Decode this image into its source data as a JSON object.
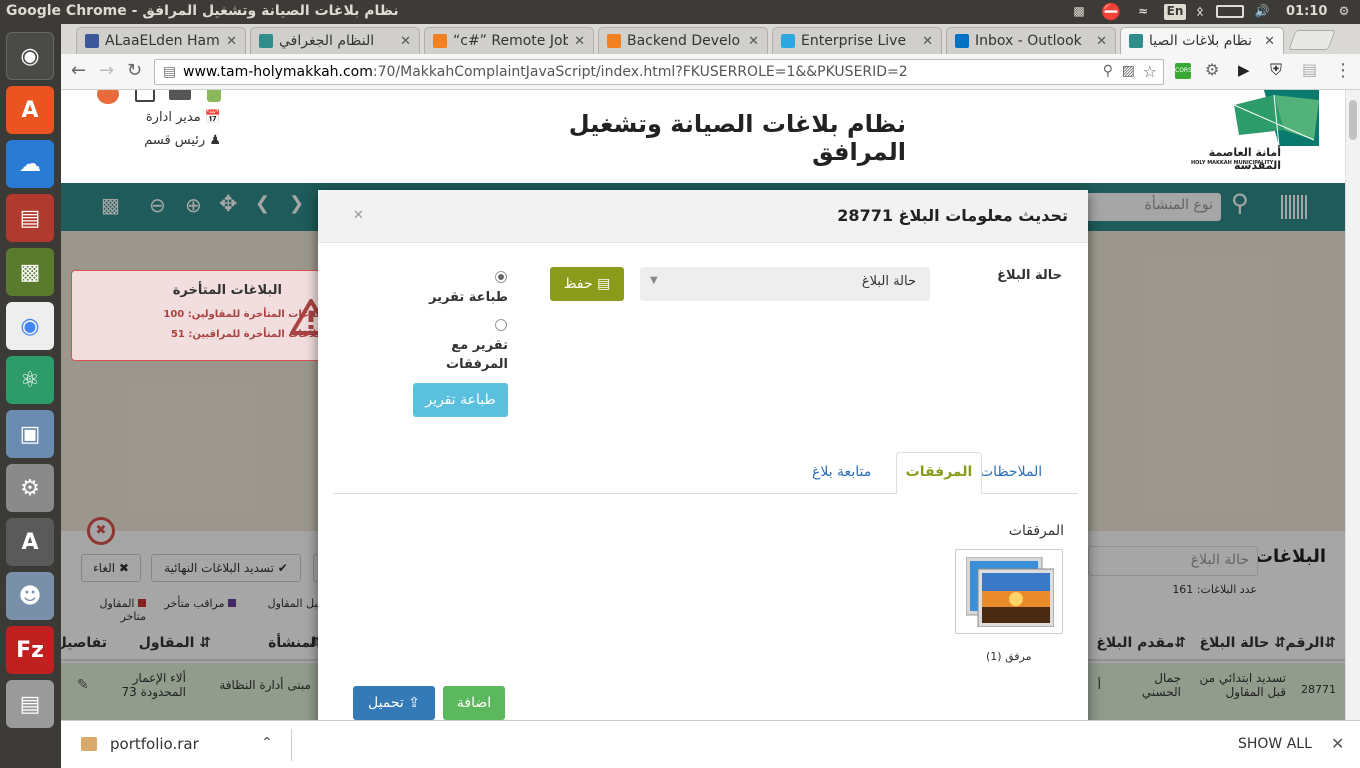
{
  "system": {
    "window_title": "Google Chrome - نظام بلاغات الصيانة وتشغيل المرافق",
    "lang": "En",
    "clock": "01:10"
  },
  "tabs": [
    {
      "label": "ALaaELden Ham",
      "color": "#3b5998"
    },
    {
      "label": "النظام الجغرافي",
      "color": "#2f8d8a"
    },
    {
      "label": "“c#” Remote Job",
      "color": "#f48024"
    },
    {
      "label": "Backend Develo",
      "color": "#f48024"
    },
    {
      "label": "Enterprise Live",
      "color": "#2ea7e0"
    },
    {
      "label": "Inbox - Outlook",
      "color": "#0072c6"
    },
    {
      "label": "نظام بلاغات الصيا",
      "color": "#2f8d8a"
    }
  ],
  "address": {
    "host": "www.tam-holymakkah.com",
    "path": ":70/MakkahComplaintJavaScript/index.html?FKUSERROLE=1&&PKUSERID=2"
  },
  "header": {
    "title": "نظام بلاغات الصيانة وتشغيل المرافق",
    "logo_ar": "أمانة العاصمة المقدسة",
    "logo_en": "HOLY MAKKAH MUNICIPALITY",
    "role1": "مدير ادارة",
    "role2": "رئيس قسم"
  },
  "mapbar": {
    "search_placeholder": "نوع المنشأة"
  },
  "late_alert": {
    "title": "البلاغات المتأخرة",
    "line1": "عدد البلاغات المتأخرة للمقاولين: 100",
    "line2": "عدد البلاغات المتأخرة للمراقبين: 51"
  },
  "modal": {
    "title": "تحديث معلومات البلاغ 28771",
    "status_label": "حالة البلاغ",
    "status_value": "حالة البلاغ",
    "save_label": "حفظ",
    "radio1": "طباعة تقرير",
    "radio2_line1": "تقرير مع",
    "radio2_line2": "المرفقات",
    "print_label": "طباعة تقرير",
    "tabs": [
      "الملاحظات",
      "المرفقات",
      "متابعة بلاغ"
    ],
    "attach_heading": "المرفقات",
    "attach_caption": "مرفق (1)",
    "add_label": "اضافة",
    "upload_label": "تحميل"
  },
  "reports": {
    "heading": "البلاغات",
    "search_placeholder": "حالة البلاغ",
    "count_text": "عدد البلاغات: 161",
    "cancel_label": "الغاء",
    "settle_label": "تسديد البلاغات النهائية",
    "legend": [
      {
        "label": "المقاول متاخر",
        "color": "#c9302c"
      },
      {
        "label": "مراقب متأخر",
        "color": "#6a3d9a"
      },
      {
        "label": "قبل المقاول",
        "color": "#5cb85c"
      }
    ],
    "columns": [
      "الرقم",
      "حالة البلاغ",
      "مقدم البلاغ",
      "المنشأة",
      "المقاول",
      "تفاصيل"
    ],
    "row": {
      "number": "28771",
      "status": "تسديد ابتدائي من قبل المقاول",
      "submitter": "جمال الحسني",
      "submitter_clip": "أ",
      "facility": "مبنى أدارة النظافة",
      "contractor": "ألاء الإعمار المحدودة 73"
    }
  },
  "downloads": {
    "file": "portfolio.rar",
    "show_all": "SHOW ALL"
  }
}
